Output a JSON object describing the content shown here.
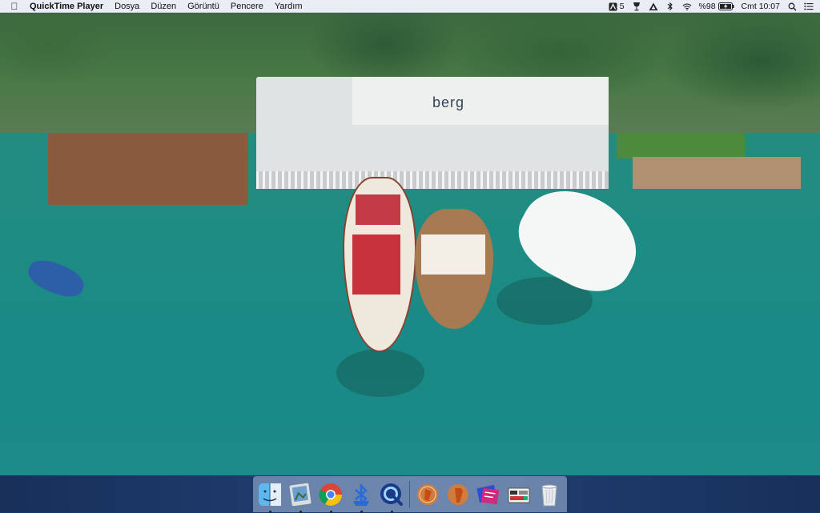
{
  "menubar": {
    "apple_icon": "apple-icon",
    "app_name": "QuickTime Player",
    "menus": [
      "Dosya",
      "Düzen",
      "Görüntü",
      "Pencere",
      "Yardım"
    ],
    "status": {
      "adobe_badge_count": "5",
      "battery_percent": "%98",
      "clock": "Cmt 10:07"
    }
  },
  "video": {
    "sign_text": "berg"
  },
  "dock": {
    "items": [
      {
        "name": "finder",
        "running": true
      },
      {
        "name": "preview",
        "running": true
      },
      {
        "name": "chrome",
        "running": true
      },
      {
        "name": "bluetooth-file-exchange",
        "running": true
      },
      {
        "name": "quicktime-player",
        "running": true
      },
      {
        "name": "downloads-stack",
        "running": false
      },
      {
        "name": "documents-stack",
        "running": false
      },
      {
        "name": "recent-folder-stack",
        "running": false
      },
      {
        "name": "screenshots-stack",
        "running": false
      },
      {
        "name": "trash",
        "running": false
      }
    ]
  },
  "colors": {
    "water": "#1e8b84",
    "menubar": "#e9eef5",
    "gulet_canopy": "#c8323c"
  }
}
